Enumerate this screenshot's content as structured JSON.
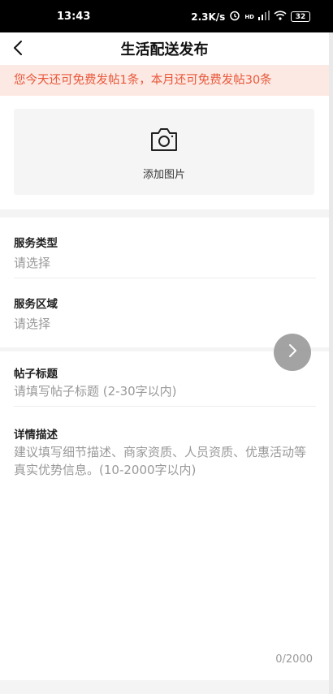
{
  "status_bar": {
    "time": "13:43",
    "net_speed": "2.3K/s",
    "network_type": "HD",
    "battery": "32"
  },
  "header": {
    "title": "生活配送发布"
  },
  "notice": {
    "text": "您今天还可免费发帖1条，本月还可免费发帖30条"
  },
  "photo": {
    "label": "添加图片"
  },
  "form": {
    "service_type": {
      "label": "服务类型",
      "placeholder": "请选择"
    },
    "service_area": {
      "label": "服务区域",
      "placeholder": "请选择"
    },
    "post_title": {
      "label": "帖子标题",
      "placeholder": "请填写帖子标题 (2-30字以内)"
    },
    "description": {
      "label": "详情描述",
      "placeholder": "建议填写细节描述、商家资质、人员资质、优惠活动等真实优势信息。(10-2000字以内)",
      "counter": "0/2000"
    }
  },
  "colors": {
    "notice_bg": "#fde9e3",
    "notice_text": "#e8573a"
  }
}
